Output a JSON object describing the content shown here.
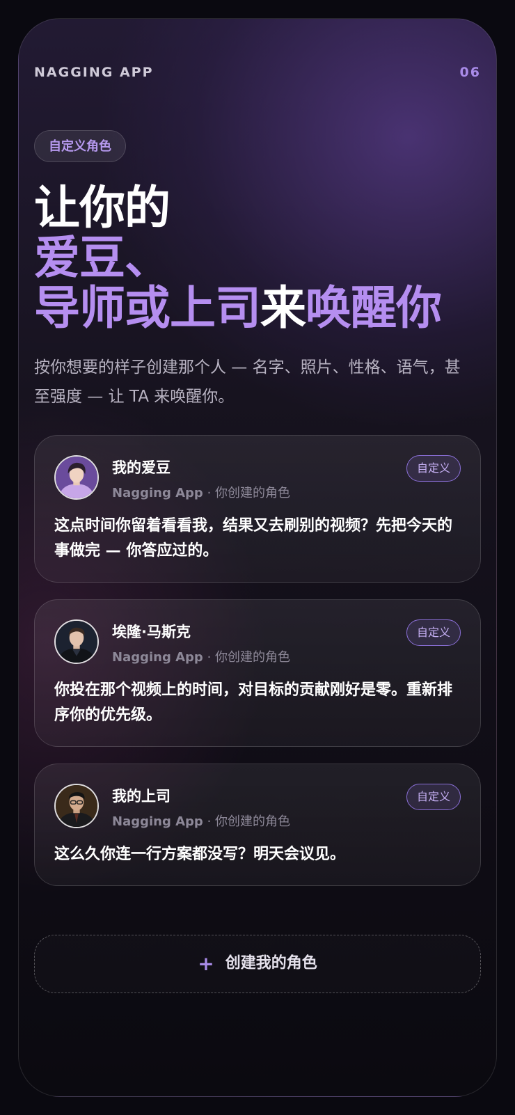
{
  "header": {
    "app_name": "NAGGING APP",
    "page_number": "06"
  },
  "hero": {
    "tag": "自定义角色",
    "headline_line1": "让你的",
    "headline_line2": "爱豆、",
    "headline_line3_before": "导师或上司",
    "headline_line3_emphasis": "来",
    "headline_line3_after": "唤醒你",
    "subtitle": "按你想要的样子创建那个人 — 名字、照片、性格、语气，甚至强度 — 让 TA 来唤醒你。"
  },
  "cards": [
    {
      "avatar": "idol-avatar",
      "name": "我的爱豆",
      "meta_app": "Nagging App",
      "meta_separator": "·",
      "meta_note": "你创建的角色",
      "badge": "自定义",
      "message": "这点时间你留着看看我，结果又去刷别的视频？先把今天的事做完 — 你答应过的。"
    },
    {
      "avatar": "elon-avatar",
      "name": "埃隆·马斯克",
      "meta_app": "Nagging App",
      "meta_separator": "·",
      "meta_note": "你创建的角色",
      "badge": "自定义",
      "message": "你投在那个视频上的时间，对目标的贡献刚好是零。重新排序你的优先级。"
    },
    {
      "avatar": "boss-avatar",
      "name": "我的上司",
      "meta_app": "Nagging App",
      "meta_separator": "·",
      "meta_note": "你创建的角色",
      "badge": "自定义",
      "message": "这么久你连一行方案都没写？明天会议见。"
    }
  ],
  "create_button": {
    "icon": "plus-icon",
    "label": "创建我的角色"
  },
  "colors": {
    "accent": "#a98be8",
    "headline_accent": "#b58ef0",
    "background": "#0a0910"
  }
}
